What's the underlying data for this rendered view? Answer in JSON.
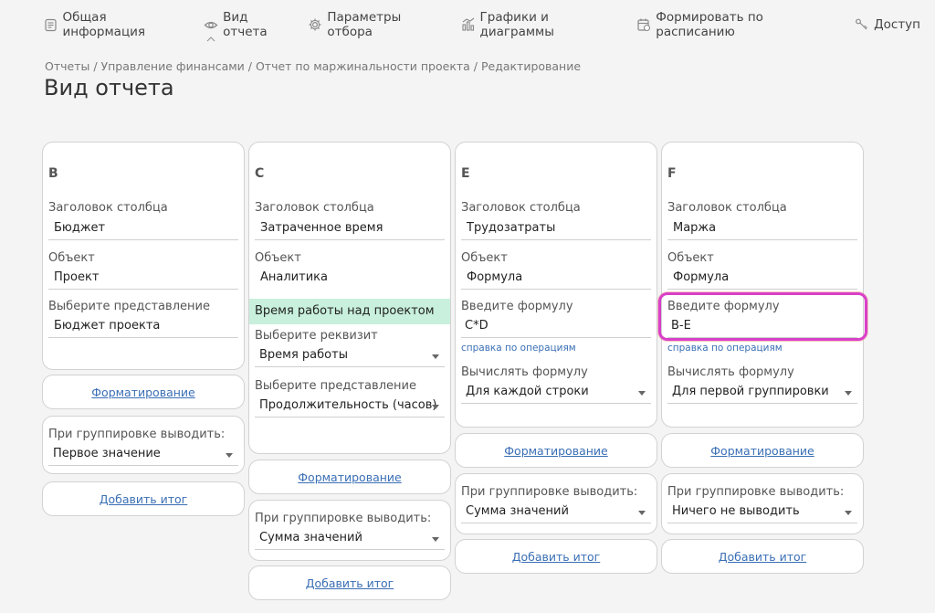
{
  "nav": {
    "items": [
      {
        "label": "Общая информация",
        "icon": "document-icon"
      },
      {
        "label": "Вид отчета",
        "icon": "eye-icon"
      },
      {
        "label": "Параметры отбора",
        "icon": "gear-icon"
      },
      {
        "label": "Графики и диаграммы",
        "icon": "chart-icon"
      },
      {
        "label": "Формировать по расписанию",
        "icon": "calendar-icon"
      },
      {
        "label": "Доступ",
        "icon": "key-icon"
      }
    ]
  },
  "breadcrumb": "Отчеты / Управление финансами / Отчет по маржинальности проекта / Редактирование",
  "title": "Вид отчета",
  "columns": {
    "b": {
      "letter": "B",
      "header_label": "Заголовок столбца",
      "header_value": "Бюджет",
      "object_label": "Объект",
      "object_value": "Проект",
      "view_label": "Выберите представление",
      "view_value": "Бюджет проекта",
      "formatting": "Форматирование",
      "group_label": "При группировке выводить:",
      "group_value": "Первое значение",
      "add_total": "Добавить итог"
    },
    "c": {
      "letter": "C",
      "header_label": "Заголовок столбца",
      "header_value": "Затраченное время",
      "object_label": "Объект",
      "object_value": "Аналитика",
      "analytic_value": "Время работы над проектом",
      "req_label": "Выберите реквизит",
      "req_value": "Время работы",
      "view_label": "Выберите представление",
      "view_value": "Продолжительность (часов)",
      "formatting": "Форматирование",
      "group_label": "При группировке выводить:",
      "group_value": "Сумма значений",
      "add_total": "Добавить итог"
    },
    "e": {
      "letter": "E",
      "header_label": "Заголовок столбца",
      "header_value": "Трудозатраты",
      "object_label": "Объект",
      "object_value": "Формула",
      "formula_label": "Введите формулу",
      "formula_value": "C*D",
      "help": "справка по операциям",
      "calc_label": "Вычислять формулу",
      "calc_value": "Для каждой строки",
      "formatting": "Форматирование",
      "group_label": "При группировке выводить:",
      "group_value": "Сумма значений",
      "add_total": "Добавить итог"
    },
    "f": {
      "letter": "F",
      "header_label": "Заголовок столбца",
      "header_value": "Маржа",
      "object_label": "Объект",
      "object_value": "Формула",
      "formula_label": "Введите формулу",
      "formula_value": "B-E",
      "help": "справка по операциям",
      "calc_label": "Вычислять формулу",
      "calc_value": "Для первой группировки",
      "formatting": "Форматирование",
      "group_label": "При группировке выводить:",
      "group_value": "Ничего не выводить",
      "add_total": "Добавить итог"
    }
  },
  "colors": {
    "link": "#3a6fb5",
    "highlight_row": "#c8f0dc",
    "focus_outline": "#d940c8"
  }
}
